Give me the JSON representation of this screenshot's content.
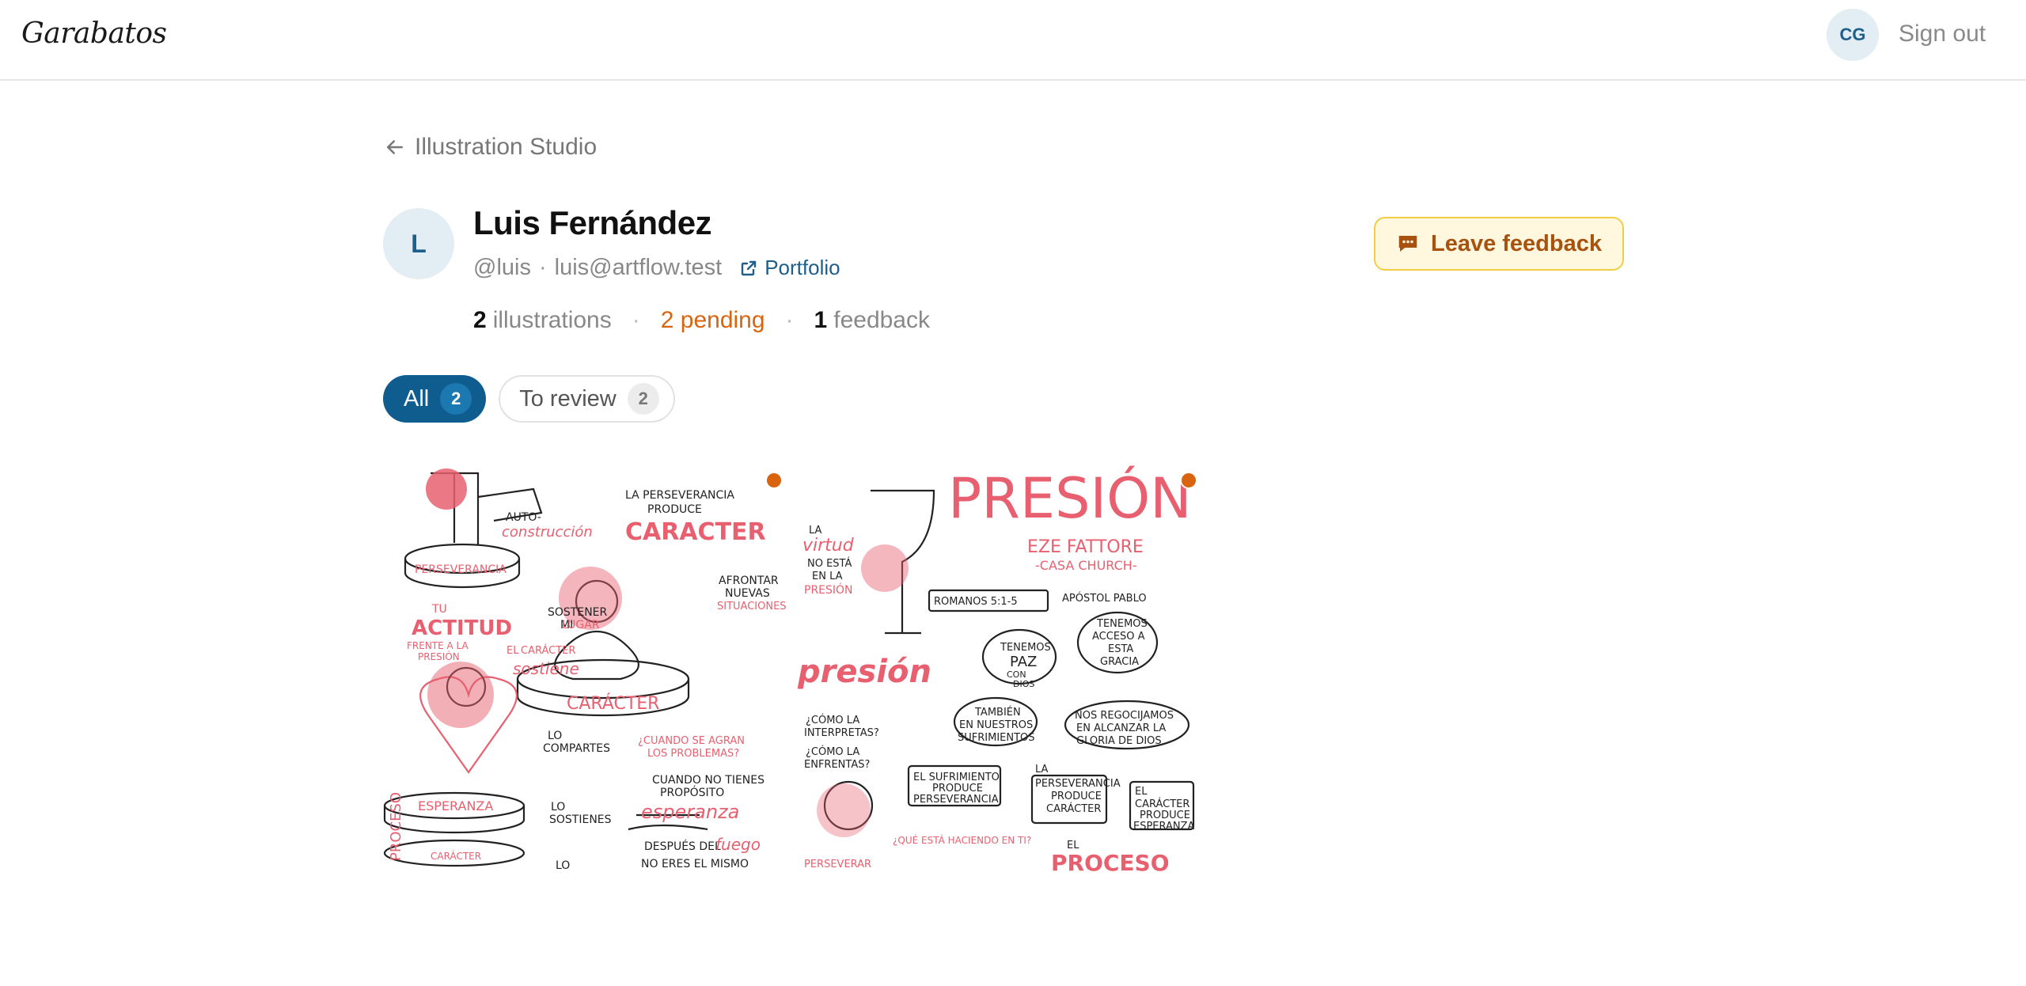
{
  "app": {
    "brand": "Garabatos"
  },
  "header": {
    "user_initials": "CG",
    "signout_label": "Sign out"
  },
  "nav": {
    "back_label": "Illustration Studio"
  },
  "profile": {
    "initial": "L",
    "name": "Luis Fernández",
    "handle": "@luis",
    "email": "luis@artflow.test",
    "portfolio_label": "Portfolio"
  },
  "stats": {
    "illustrations_count": "2",
    "illustrations_label": "illustrations",
    "pending_label": "2 pending",
    "feedback_count": "1",
    "feedback_label": "feedback"
  },
  "actions": {
    "leave_feedback_label": "Leave feedback"
  },
  "filters": [
    {
      "label": "All",
      "count": "2",
      "active": true
    },
    {
      "label": "To review",
      "count": "2",
      "active": false
    }
  ],
  "illustrations": [
    {
      "texts": {
        "a": "AUTO-",
        "b": "construcción",
        "c": "PERSEVERANCIA",
        "d": "LA PERSEVERANCIA",
        "e": "PRODUCE",
        "f": "CARACTER",
        "g": "TU",
        "h": "ACTITUD",
        "i": "FRENTE A LA",
        "j": "PRESIÓN",
        "k": "SOSTENER",
        "l": "MI",
        "m": "LUGAR",
        "n": "AFRONTAR",
        "o": "NUEVAS",
        "p": "SITUACIONES",
        "q": "EL",
        "r": "CARÁCTER",
        "s": "sostiene",
        "t": "CARÁCTER",
        "u": "LO",
        "v": "COMPARTES",
        "w": "¿CUANDO SE AGRAN",
        "x": "LOS PROBLEMAS?",
        "y": "CUANDO NO TIENES",
        "z": "PROPÓSITO",
        "aa": "ESPERANZA",
        "ab": "LO",
        "ac": "SOSTIENES",
        "ad": "esperanza",
        "ae": "PROCESO",
        "af": "CARÁCTER",
        "ag": "DESPUÉS DEL",
        "ah": "fuego",
        "ai": "NO ERES EL MISMO",
        "aj": "LO"
      }
    },
    {
      "texts": {
        "a": "PRESIÓN",
        "b": "EZE FATTORE",
        "c": "-CASA CHURCH-",
        "d": "LA",
        "e": "virtud",
        "f": "NO ESTÁ",
        "g": "EN LA",
        "h": "PRESIÓN",
        "i": "ROMANOS 5:1-5",
        "j": "APÓSTOL PABLO",
        "k": "TENEMOS",
        "l": "PAZ",
        "m": "CON",
        "n": "DIOS",
        "o": "TENEMOS",
        "p": "ACCESO A",
        "q": "ESTA",
        "r": "GRACIA",
        "s": "presión",
        "t": "TAMBIÉN",
        "u": "EN NUESTROS",
        "v": "SUFRIMIENTOS",
        "w": "NOS REGOCIJAMOS",
        "x": "EN ALCANZAR LA",
        "y": "GLORIA DE DIOS",
        "z": "¿CÓMO LA",
        "aa": "INTERPRETAS?",
        "ab": "¿CÓMO LA",
        "ac": "ENFRENTAS?",
        "ad": "EL SUFRIMIENTO",
        "ae": "PRODUCE",
        "af": "PERSEVERANCIA",
        "ag": "LA",
        "ah": "PERSEVERANCIA",
        "ai": "PRODUCE",
        "aj": "CARÁCTER",
        "ak": "EL",
        "al": "CARÁCTER",
        "am": "PRODUCE",
        "an": "ESPERANZA",
        "ao": "PERSEVERAR",
        "ap": "¿QUÉ ESTÁ HACIENDO EN TI?",
        "aq": "EL",
        "ar": "PROCESO"
      }
    }
  ],
  "colors": {
    "accent": "#0e5d8e",
    "pending": "#d9640f",
    "feedback_bg": "#fff8df",
    "feedback_border": "#f1cd46",
    "art_red": "#e8606f"
  }
}
